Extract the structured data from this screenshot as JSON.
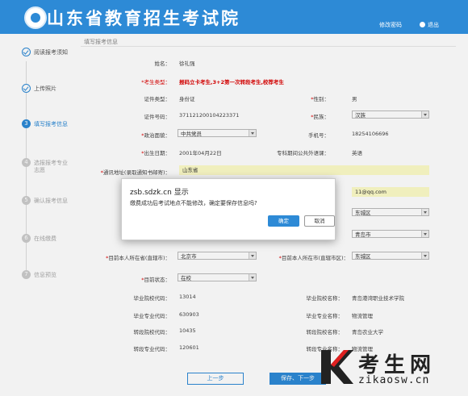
{
  "header": {
    "brand": "山东省教育招生考试院",
    "change_password": "修改密码",
    "logout": "退出"
  },
  "steps": [
    {
      "label": "阅读报考须知",
      "state": "done"
    },
    {
      "label": "上传照片",
      "state": "done"
    },
    {
      "label": "填写报考信息",
      "state": "current",
      "num": "3"
    },
    {
      "label": "选报报考专业",
      "label2": "志愿",
      "state": "todo",
      "num": "4"
    },
    {
      "label": "确认报考信息",
      "state": "todo",
      "num": "5"
    },
    {
      "label": "在线缴费",
      "state": "todo",
      "num": "6"
    },
    {
      "label": "信息预览",
      "state": "todo",
      "num": "7"
    }
  ],
  "form": {
    "section_title": "填写报考信息",
    "name_label": "姓名：",
    "name": "徐礼强",
    "type_label": "考生类型：",
    "type_value": "报码立卡考生,3+2第一次转段考生,校荐考生",
    "id_type_label": "证件类型：",
    "id_type": "身份证",
    "gender_label": "性别：",
    "gender": "男",
    "id_no_label": "证件号码：",
    "id_no": "371121200104223371",
    "ethnic_label": "民族：",
    "ethnic": "汉族",
    "political_label": "政治面貌：",
    "political": "中共党员",
    "phone_label": "手机号：",
    "phone": "18254106696",
    "birth_label": "出生日期：",
    "birth": "2001年04月22日",
    "foreign_label": "专科期间公共外语课：",
    "foreign": "英语",
    "address_label": "通讯地址(录取通知书邮寄)：",
    "address": "山东省",
    "email_partial": "11@qq.com",
    "district1": "东城区",
    "city_right": "青岛市",
    "cur_province_label": "目前本人所在省(直辖市)：",
    "cur_province": "北京市",
    "cur_city_label": "目前本人所在市(直辖市区)：",
    "cur_city": "东城区",
    "status_label": "目前状态：",
    "status": "在校",
    "school_code_label": "毕业院校代码：",
    "school_code": "13014",
    "school_name_label": "毕业院校名称：",
    "school_name": "青岛港湾职业技术学院",
    "major_code_label": "毕业专业代码：",
    "major_code": "630903",
    "major_name_label": "毕业专业名称：",
    "major_name": "物流管理",
    "transfer_school_code_label": "转段院校代码：",
    "transfer_school_code": "10435",
    "transfer_school_name_label": "转段院校名称：",
    "transfer_school_name": "青岛农业大学",
    "transfer_major_code_label": "转段专业代码：",
    "transfer_major_code": "120601",
    "transfer_major_name_label": "转段专业名称：",
    "transfer_major_name": "物流管理"
  },
  "dialog": {
    "title": "zsb.sdzk.cn 显示",
    "message": "缴费成功后考试地点不能修改，确定要保存信息吗?",
    "ok": "确定",
    "cancel": "取消"
  },
  "buttons": {
    "prev": "上一步",
    "next": "保存、下一步"
  },
  "watermark": {
    "cn": "考生网",
    "url": "zikaosw.cn"
  },
  "colors": {
    "primary": "#2d8ad6",
    "required": "#dd0000",
    "highlight": "#fdfcc8"
  }
}
